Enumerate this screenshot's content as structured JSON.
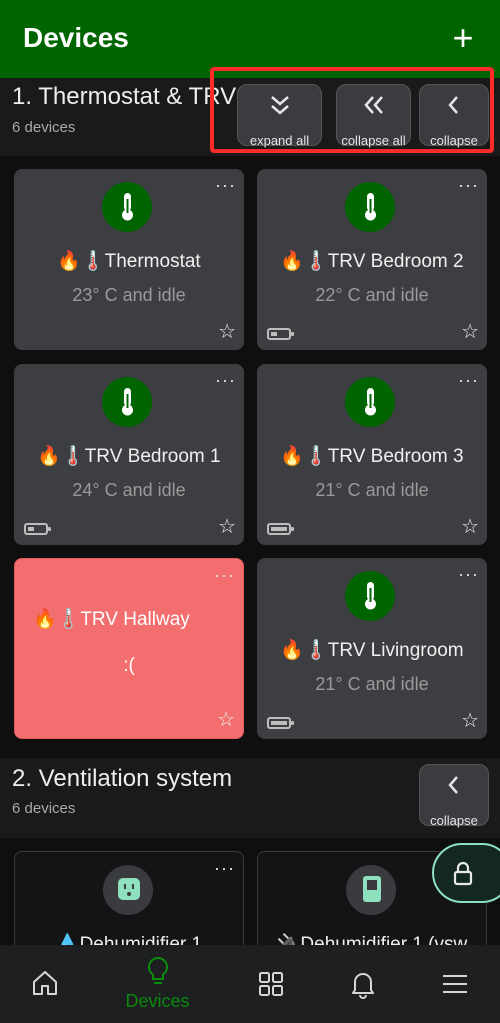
{
  "appbar": {
    "title": "Devices",
    "add_label": "+"
  },
  "sections": [
    {
      "title": "1. Thermostat & TRV",
      "subtitle": "6 devices"
    },
    {
      "title": "2. Ventilation system",
      "subtitle": "6 devices"
    }
  ],
  "header_buttons": {
    "expand_all": "expand all",
    "collapse_all": "collapse all",
    "collapse": "collapse"
  },
  "devices": [
    {
      "name": "🔥🌡️Thermostat",
      "state": "23° C and idle",
      "battery": null
    },
    {
      "name": "🔥🌡️TRV Bedroom 2",
      "state": "22° C and idle",
      "battery": "low"
    },
    {
      "name": "🔥🌡️TRV Bedroom 1",
      "state": "24° C and idle",
      "battery": "low"
    },
    {
      "name": "🔥🌡️TRV Bedroom 3",
      "state": "21° C and idle",
      "battery": "full"
    },
    {
      "name": "🔥🌡️TRV Hallway",
      "state": ":(",
      "battery": null,
      "error": true
    },
    {
      "name": "🔥🌡️TRV Livingroom",
      "state": "21° C and idle",
      "battery": "full"
    }
  ],
  "ventilation_devices": [
    {
      "name": "💧Dehumidifier 1"
    },
    {
      "name": "🔌Dehumidifier 1 (vsw"
    }
  ],
  "card_more": "···",
  "card_star": "☆",
  "bottom_nav": {
    "devices_label": "Devices"
  },
  "colors": {
    "appbar": "#006400",
    "card": "#3d3e42",
    "error_card": "#f36f6f",
    "highlight": "#ff2b2b",
    "lock_border": "#8fe0bf"
  }
}
